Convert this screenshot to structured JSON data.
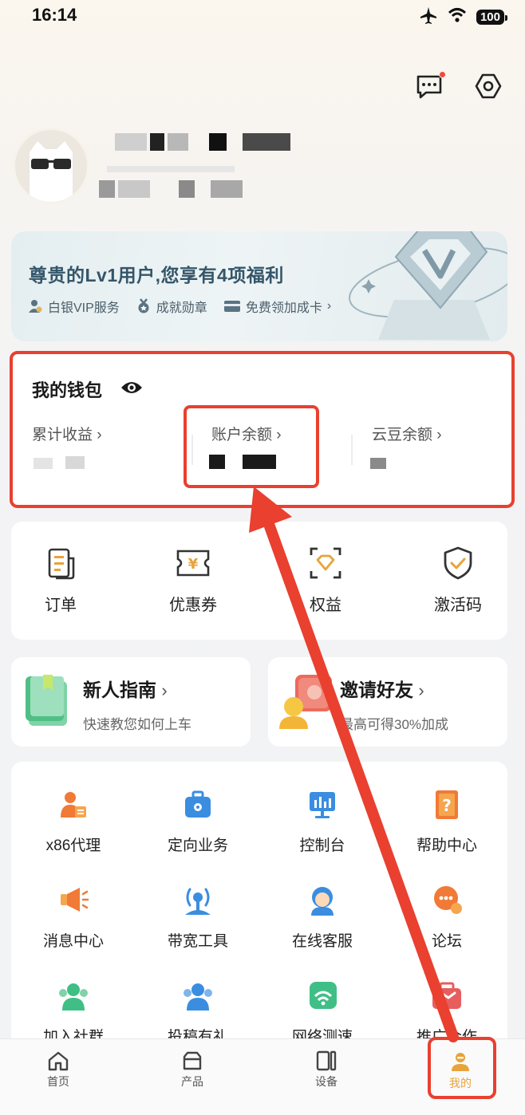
{
  "status_bar": {
    "time": "16:14",
    "battery": "100"
  },
  "vip": {
    "title": "尊贵的Lv1用户,您享有4项福利",
    "benefits": [
      "白银VIP服务",
      "成就勋章",
      "免费领加成卡"
    ]
  },
  "wallet": {
    "title": "我的钱包",
    "items": [
      {
        "label": "累计收益 ›"
      },
      {
        "label": "账户余额 ›"
      },
      {
        "label": "云豆余额 ›"
      }
    ]
  },
  "quick": [
    {
      "label": "订单"
    },
    {
      "label": "优惠券"
    },
    {
      "label": "权益"
    },
    {
      "label": "激活码"
    }
  ],
  "guide": {
    "title": "新人指南",
    "subtitle": "快速教您如何上车"
  },
  "invite": {
    "title": "邀请好友",
    "subtitle": "最高可得30%加成"
  },
  "services": [
    {
      "label": "x86代理"
    },
    {
      "label": "定向业务"
    },
    {
      "label": "控制台"
    },
    {
      "label": "帮助中心"
    },
    {
      "label": "消息中心"
    },
    {
      "label": "带宽工具"
    },
    {
      "label": "在线客服"
    },
    {
      "label": "论坛"
    },
    {
      "label": "加入社群"
    },
    {
      "label": "投稿有礼"
    },
    {
      "label": "网络测速"
    },
    {
      "label": "推广合作"
    }
  ],
  "nav": [
    {
      "label": "首页"
    },
    {
      "label": "产品"
    },
    {
      "label": "设备"
    },
    {
      "label": "我的"
    }
  ],
  "colors": {
    "accent_orange": "#e8a33a",
    "annotation_red": "#e9402f",
    "vip_text": "#35566a"
  }
}
